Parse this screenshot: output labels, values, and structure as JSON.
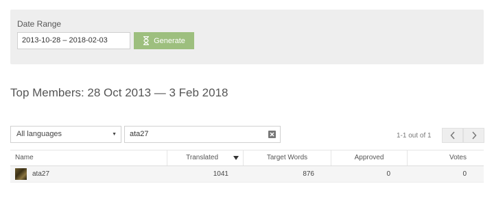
{
  "filters": {
    "date_range_label": "Date Range",
    "date_range_value": "2013-10-28 – 2018-02-03",
    "generate_label": "Generate"
  },
  "page_title": "Top Members: 28 Oct 2013 — 3 Feb 2018",
  "controls": {
    "language_select": "All languages",
    "search_value": "ata27",
    "pager_text": "1-1 out of 1"
  },
  "table": {
    "columns": [
      "Name",
      "Translated",
      "Target Words",
      "Approved",
      "Votes"
    ],
    "sorted_column": "Translated",
    "rows": [
      {
        "name": "ata27",
        "translated": "1041",
        "target_words": "876",
        "approved": "0",
        "votes": "0"
      }
    ]
  },
  "colors": {
    "accent_green": "#9dbf7e",
    "panel_bg": "#eeeeee"
  }
}
